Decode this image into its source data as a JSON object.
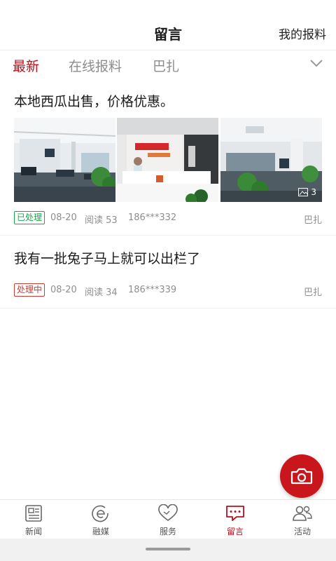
{
  "header": {
    "title": "留言",
    "action_label": "我的报料"
  },
  "tabs": [
    {
      "label": "最新",
      "active": true
    },
    {
      "label": "在线报料",
      "active": false
    },
    {
      "label": "巴扎",
      "active": false
    }
  ],
  "tab_expand_icon": "chevron-down-icon",
  "posts": [
    {
      "title": "本地西瓜出售，价格优惠。",
      "images": [
        "office-photo-1",
        "reception-photo",
        "office-photo-2"
      ],
      "photo_count": "3",
      "status": "已处理",
      "status_color": "#18a84a",
      "date": "08-20",
      "reads": "阅读 53",
      "phone": "186***332",
      "location": "巴扎"
    },
    {
      "title": "我有一批兔子马上就可以出栏了",
      "status": "处理中",
      "status_color": "#c93b35",
      "date": "08-20",
      "reads": "阅读 34",
      "phone": "186***339",
      "location": "巴扎"
    }
  ],
  "fab": {
    "icon": "camera-icon"
  },
  "bottom_nav": [
    {
      "label": "新闻",
      "icon": "newspaper-icon",
      "active": false
    },
    {
      "label": "融媒",
      "icon": "media-icon",
      "active": false
    },
    {
      "label": "服务",
      "icon": "heart-icon",
      "active": false
    },
    {
      "label": "留言",
      "icon": "message-icon",
      "active": true
    },
    {
      "label": "活动",
      "icon": "people-icon",
      "active": false
    }
  ],
  "colors": {
    "accent": "#b8121c",
    "fab": "#c9161d",
    "done": "#18a84a",
    "pending": "#c93b35"
  }
}
